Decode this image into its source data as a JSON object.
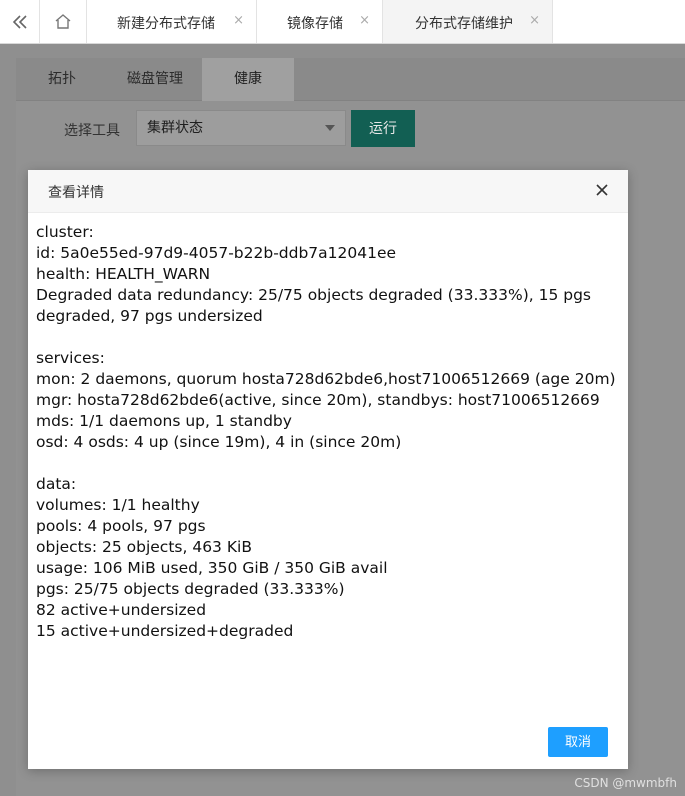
{
  "topbar": {
    "tabs": [
      {
        "label": "新建分布式存储"
      },
      {
        "label": "镜像存储"
      },
      {
        "label": "分布式存储维护"
      }
    ],
    "close_glyph": "×"
  },
  "subtabs": [
    "拓扑",
    "磁盘管理",
    "健康"
  ],
  "toolbar": {
    "tool_label": "选择工具",
    "selected_tool": "集群状态",
    "run_label": "运行"
  },
  "modal": {
    "title": "查看详情",
    "lines": [
      "cluster:",
      "id: 5a0e55ed-97d9-4057-b22b-ddb7a12041ee",
      "health: HEALTH_WARN",
      "Degraded data redundancy: 25/75 objects degraded (33.333%), 15 pgs",
      "degraded, 97 pgs undersized",
      "",
      "services:",
      "mon: 2 daemons, quorum hosta728d62bde6,host71006512669 (age 20m)",
      "mgr: hosta728d62bde6(active, since 20m), standbys: host71006512669",
      "mds: 1/1 daemons up, 1 standby",
      "osd: 4 osds: 4 up (since 19m), 4 in (since 20m)",
      "",
      "data:",
      "volumes: 1/1 healthy",
      "pools: 4 pools, 97 pgs",
      "objects: 25 objects, 463 KiB",
      "usage: 106 MiB used, 350 GiB / 350 GiB avail",
      "pgs: 25/75 objects degraded (33.333%)",
      "82 active+undersized",
      "15 active+undersized+degraded"
    ],
    "cancel_label": "取消"
  },
  "watermark": "CSDN @mwmbfh",
  "colors": {
    "run_button": "#125f53",
    "cancel_button": "#1e9fff"
  },
  "icons": {
    "collapse": "double-chevron-left-icon",
    "home": "home-icon",
    "close": "close-icon",
    "dropdown": "caret-down-icon"
  }
}
